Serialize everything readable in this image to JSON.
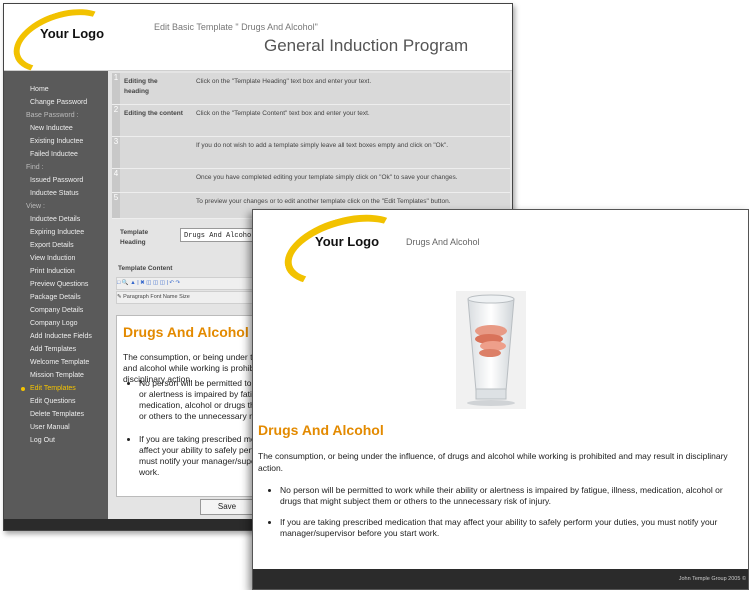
{
  "back_window": {
    "logo": "Your Logo",
    "subtitle": "Edit Basic Template \" Drugs And Alcohol\"",
    "title": "General Induction Program",
    "sidebar": [
      {
        "label": "Home",
        "type": "item"
      },
      {
        "label": "Change Password",
        "type": "item"
      },
      {
        "label": "Base Password :",
        "type": "group"
      },
      {
        "label": "New Inductee",
        "type": "item"
      },
      {
        "label": "Existing Inductee",
        "type": "item"
      },
      {
        "label": "Failed Inductee",
        "type": "item"
      },
      {
        "label": "Find :",
        "type": "group"
      },
      {
        "label": "Issued Password",
        "type": "item"
      },
      {
        "label": "Inductee Status",
        "type": "item"
      },
      {
        "label": "View :",
        "type": "group"
      },
      {
        "label": "Inductee Details",
        "type": "item"
      },
      {
        "label": "Expiring Inductee",
        "type": "item"
      },
      {
        "label": "Export Details",
        "type": "item"
      },
      {
        "label": "View Induction",
        "type": "item"
      },
      {
        "label": "Print Induction",
        "type": "item"
      },
      {
        "label": "Preview Questions",
        "type": "item"
      },
      {
        "label": "Package Details",
        "type": "item"
      },
      {
        "label": "Company Details",
        "type": "item"
      },
      {
        "label": "Company Logo",
        "type": "item"
      },
      {
        "label": "Add Inductee Fields",
        "type": "item"
      },
      {
        "label": "Add Templates",
        "type": "item"
      },
      {
        "label": "Welcome Template",
        "type": "item"
      },
      {
        "label": "Mission Template",
        "type": "item"
      },
      {
        "label": "Edit Templates",
        "type": "active"
      },
      {
        "label": "Edit Questions",
        "type": "item"
      },
      {
        "label": "Delete Templates",
        "type": "item"
      },
      {
        "label": "User Manual",
        "type": "item"
      },
      {
        "label": "Log Out",
        "type": "item"
      }
    ],
    "steps": [
      {
        "num": "1",
        "label": "Editing the heading",
        "text": "Click on the \"Template Heading\" text box and enter your text."
      },
      {
        "num": "2",
        "label": "Editing the content",
        "text": "Click on the \"Template Content\" text box and enter your text."
      },
      {
        "num": "3",
        "label": "",
        "text": "If you do not wish to add a template simply leave all text boxes empty and click on \"Ok\"."
      },
      {
        "num": "4",
        "label": "",
        "text": "Once you have completed editing your template simply click on \"Ok\" to save your changes."
      },
      {
        "num": "5",
        "label": "",
        "text": "To preview your changes or to edit another template click on the \"Edit Templates\" button."
      }
    ],
    "template_heading_label": "Template Heading",
    "template_heading_value": "Drugs And Alcohol",
    "template_content_label": "Template Content",
    "toolbar_row2": "Paragraph   Font Name   Size",
    "editor": {
      "heading": "Drugs And Alcohol",
      "paragraph": "The consumption, or being under the influence, of drugs and alcohol while working is prohibited and may result in disciplinary action.",
      "bullets": [
        "No person will be permitted to work while their ability or alertness is impaired by fatigue, illness, medication, alcohol or drugs that might subject them or others to the unnecessary risk of injury.",
        "If you are taking prescribed medication that may affect your ability to safely perform your duties, you must notify your manager/supervisor before you start work."
      ]
    },
    "save_label": "Save"
  },
  "front_window": {
    "logo": "Your Logo",
    "header_title": "Drugs And Alcohol",
    "heading": "Drugs And Alcohol",
    "paragraph": "The consumption, or being under the influence, of drugs and alcohol while working is prohibited and may result in disciplinary action.",
    "bullets": [
      "No person will be permitted to work while their ability or alertness is impaired by fatigue, illness, medication, alcohol or drugs that might subject them or others to the unnecessary risk of injury.",
      "If you are taking prescribed medication that may affect your ability to safely perform your duties, you must notify your manager/supervisor before you start work."
    ],
    "footer": "John Temple Group 2005 ©"
  },
  "colors": {
    "accent_orange": "#e38a00",
    "logo_swoosh": "#f2c200",
    "sidebar_bg": "#5a5a5a",
    "active_nav": "#f5c400",
    "dark_bar": "#2b2b2b"
  }
}
